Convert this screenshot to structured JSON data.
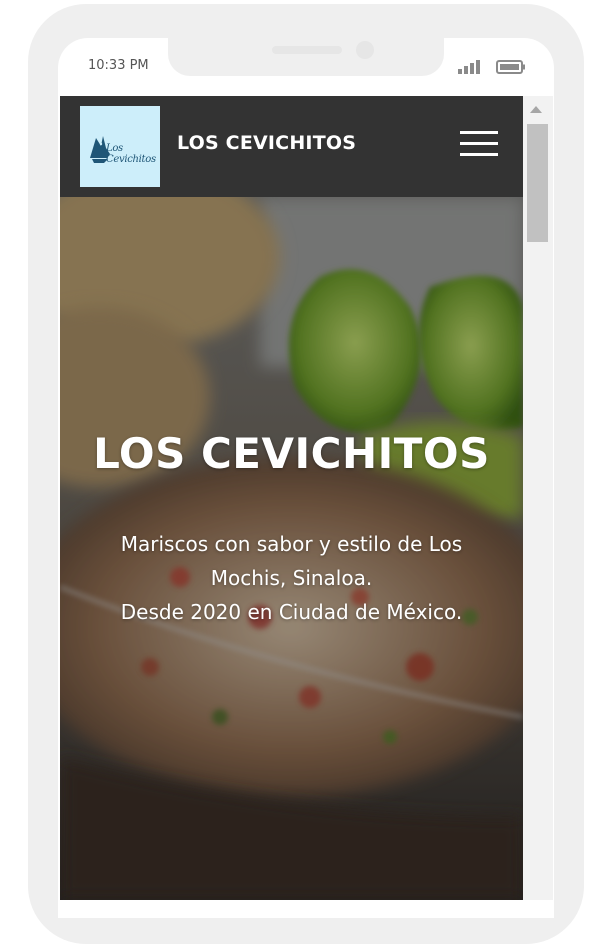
{
  "status_bar": {
    "time": "10:33 PM",
    "signal_icon": "signal-bars-icon",
    "battery_icon": "battery-icon"
  },
  "navbar": {
    "logo_text": "Los Cevichitos",
    "brand": "LOS CEVICHITOS",
    "menu_icon": "hamburger-menu-icon",
    "background": "#333333"
  },
  "hero": {
    "title": "LOS CEVICHITOS",
    "subtitle_lines": [
      "Mariscos con sabor y estilo de Los",
      "Mochis, Sinaloa.",
      "Desde 2020 en Ciudad de México."
    ]
  },
  "colors": {
    "logo_background": "#cdeefa",
    "logo_fish": "#1f5677",
    "text": "#ffffff"
  }
}
